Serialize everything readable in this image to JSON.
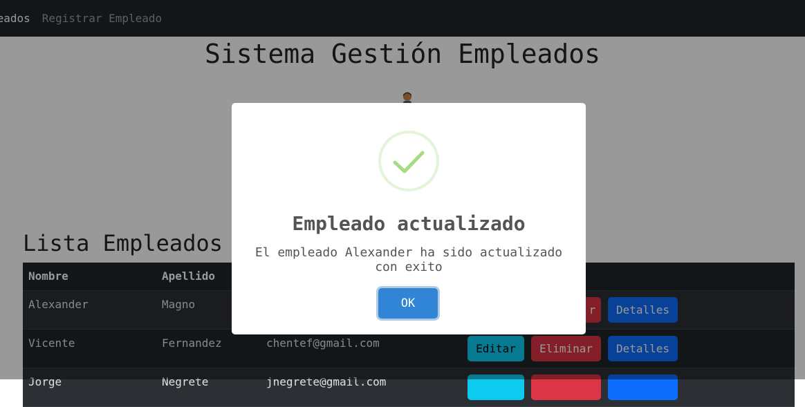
{
  "navbar": {
    "active_link": "leados",
    "register_link": "Registrar Empleado"
  },
  "page_title": "Sistema Gestión Empleados",
  "list_title": "Lista Empleados",
  "table": {
    "headers": [
      "Nombre",
      "Apellido"
    ],
    "rows": [
      {
        "nombre": "Alexander",
        "apellido": "Magno",
        "email": "",
        "del_label": "r"
      },
      {
        "nombre": "Vicente",
        "apellido": "Fernandez",
        "email": "chentef@gmail.com",
        "del_label": "Eliminar"
      },
      {
        "nombre": "Jorge",
        "apellido": "Negrete",
        "email": "jnegrete@gmail.com",
        "del_label": ""
      }
    ],
    "edit_label": "Editar",
    "details_label": "Detalles"
  },
  "modal": {
    "title": "Empleado actualizado",
    "message": "El empleado Alexander ha sido actualizado con exito",
    "ok_label": "OK",
    "icon": "checkmark-icon",
    "icon_color": "#a5dc86"
  },
  "colors": {
    "navbar": "#212529",
    "ok_button": "#3085d6",
    "edit": "#0dcaf0",
    "delete": "#dc3545",
    "details": "#0d6efd"
  }
}
